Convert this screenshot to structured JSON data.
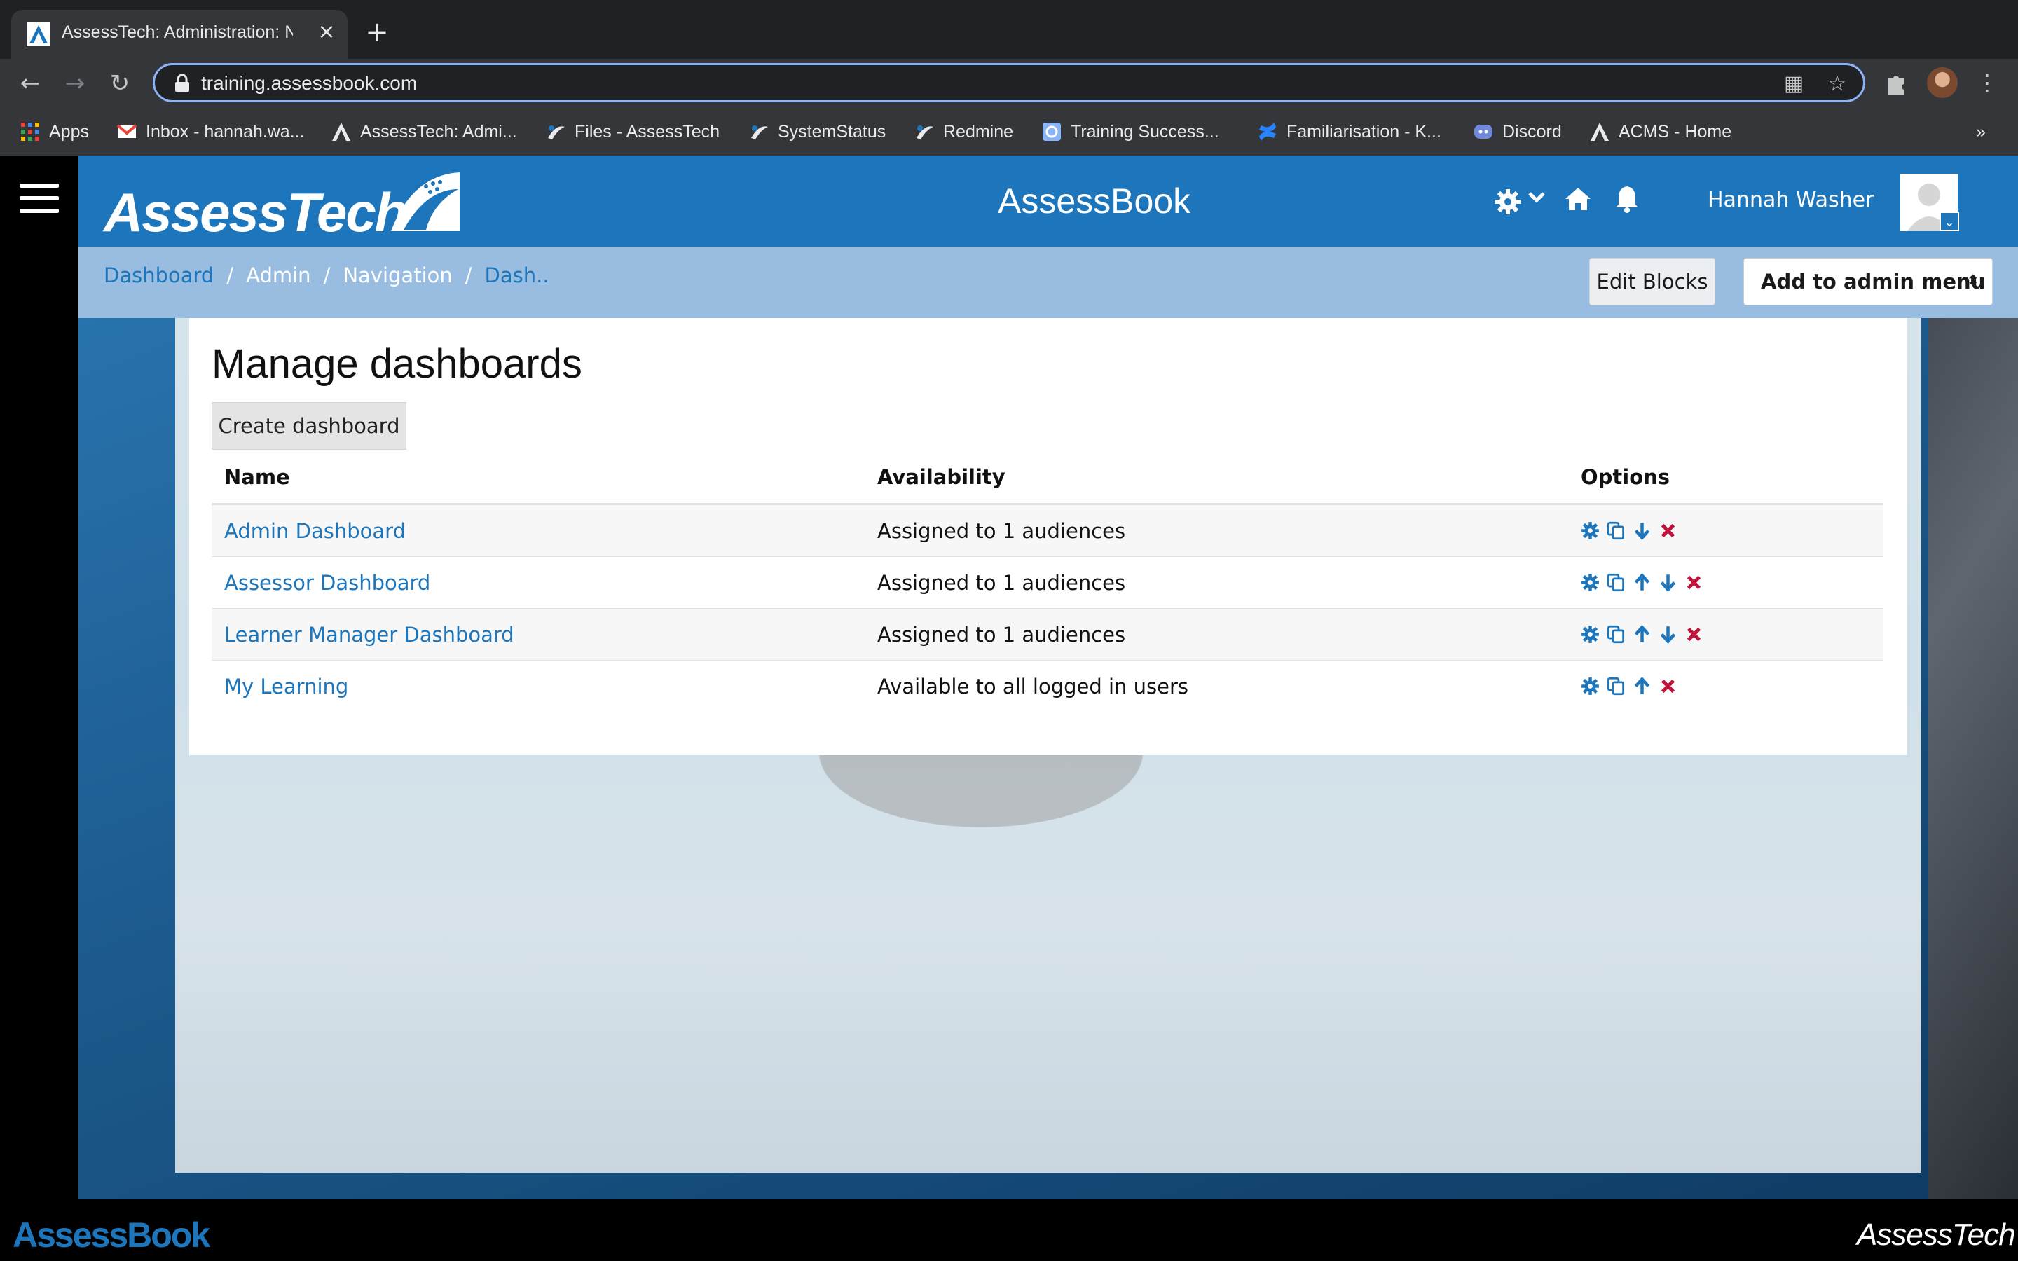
{
  "browser": {
    "tab_title": "AssessTech: Administration: Na",
    "url": "training.assessbook.com",
    "bookmarks": [
      {
        "label": "Apps",
        "icon": "apps-grid-icon"
      },
      {
        "label": "Inbox - hannah.wa...",
        "icon": "gmail-icon"
      },
      {
        "label": "AssessTech: Admi...",
        "icon": "assesstech-icon"
      },
      {
        "label": "Files - AssessTech",
        "icon": "assesstech-swoosh-icon"
      },
      {
        "label": "SystemStatus",
        "icon": "assesstech-swoosh-icon"
      },
      {
        "label": "Redmine",
        "icon": "assesstech-swoosh-icon"
      },
      {
        "label": "Training Success...",
        "icon": "training-icon"
      },
      {
        "label": "Familiarisation - K...",
        "icon": "confluence-icon"
      },
      {
        "label": "Discord",
        "icon": "discord-icon"
      },
      {
        "label": "ACMS - Home",
        "icon": "assesstech-icon"
      }
    ],
    "overflow": "»"
  },
  "header": {
    "logo_text": "AssessTech",
    "center_title": "AssessBook",
    "user_name": "Hannah Washer"
  },
  "breadcrumb": {
    "items": [
      "Dashboard",
      "Admin",
      "Navigation",
      "Dash.."
    ],
    "separator": "/"
  },
  "toolbar": {
    "edit_blocks": "Edit Blocks",
    "add_to_admin_menu": "Add to admin menu"
  },
  "main": {
    "title": "Manage dashboards",
    "create_button": "Create dashboard",
    "columns": [
      "Name",
      "Availability",
      "Options"
    ],
    "rows": [
      {
        "name": "Admin Dashboard",
        "availability": "Assigned to 1 audiences",
        "options": [
          "settings",
          "copy",
          "down",
          "delete"
        ]
      },
      {
        "name": "Assessor Dashboard",
        "availability": "Assigned to 1 audiences",
        "options": [
          "settings",
          "copy",
          "up",
          "down",
          "delete"
        ]
      },
      {
        "name": "Learner Manager Dashboard",
        "availability": "Assigned to 1 audiences",
        "options": [
          "settings",
          "copy",
          "up",
          "down",
          "delete"
        ]
      },
      {
        "name": "My Learning",
        "availability": "Available to all logged in users",
        "options": [
          "settings",
          "copy",
          "up",
          "delete"
        ]
      }
    ]
  },
  "footer": {
    "left_logo": "AssessBook",
    "powered_by": "AssessTech"
  },
  "colors": {
    "brand_blue": "#1d76bb",
    "delete_red": "#c0143c"
  }
}
